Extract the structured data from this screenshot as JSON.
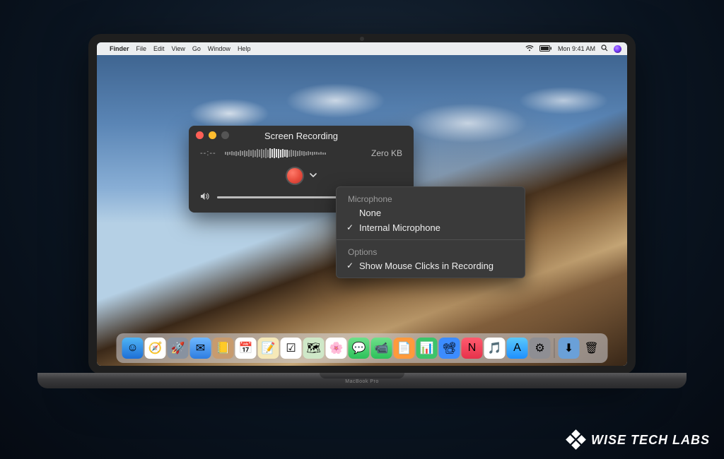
{
  "laptop": {
    "model": "MacBook Pro"
  },
  "menubar": {
    "app": "Finder",
    "items": [
      "File",
      "Edit",
      "View",
      "Go",
      "Window",
      "Help"
    ],
    "clock": "Mon 9:41 AM"
  },
  "panel": {
    "title": "Screen Recording",
    "time": "--:--",
    "size": "Zero KB"
  },
  "dropdown": {
    "section1": "Microphone",
    "opt_none": "None",
    "opt_internal": "Internal Microphone",
    "section2": "Options",
    "opt_clicks": "Show Mouse Clicks in Recording"
  },
  "dock": {
    "items": [
      {
        "name": "finder",
        "bg": "linear-gradient(#4fb4f5,#1e6fd6)",
        "glyph": "☺"
      },
      {
        "name": "safari",
        "bg": "#fff",
        "glyph": "🧭"
      },
      {
        "name": "launchpad",
        "bg": "#8892a0",
        "glyph": "🚀"
      },
      {
        "name": "mail",
        "bg": "linear-gradient(#6fb8ff,#2e7de0)",
        "glyph": "✉"
      },
      {
        "name": "contacts",
        "bg": "#c89b6e",
        "glyph": "📒"
      },
      {
        "name": "calendar",
        "bg": "#fff",
        "glyph": "📅"
      },
      {
        "name": "notes",
        "bg": "#f6e9b8",
        "glyph": "📝"
      },
      {
        "name": "reminders",
        "bg": "#fff",
        "glyph": "☑"
      },
      {
        "name": "maps",
        "bg": "#cfe8c8",
        "glyph": "🗺"
      },
      {
        "name": "photos",
        "bg": "#fff",
        "glyph": "🌸"
      },
      {
        "name": "messages",
        "bg": "linear-gradient(#6fe08a,#2cc25a)",
        "glyph": "💬"
      },
      {
        "name": "facetime",
        "bg": "linear-gradient(#6fe08a,#2cc25a)",
        "glyph": "📹"
      },
      {
        "name": "pages",
        "bg": "#ff9a3c",
        "glyph": "📄"
      },
      {
        "name": "numbers",
        "bg": "#3cc46a",
        "glyph": "📊"
      },
      {
        "name": "keynote",
        "bg": "#3c8cff",
        "glyph": "📽"
      },
      {
        "name": "news",
        "bg": "linear-gradient(#ff5b6e,#e6324b)",
        "glyph": "N"
      },
      {
        "name": "itunes",
        "bg": "#fff",
        "glyph": "🎵"
      },
      {
        "name": "appstore",
        "bg": "linear-gradient(#5ac8fa,#1e90ff)",
        "glyph": "A"
      },
      {
        "name": "preferences",
        "bg": "#8e8e93",
        "glyph": "⚙"
      }
    ],
    "extras": [
      {
        "name": "downloads",
        "bg": "#6aa0d8",
        "glyph": "⬇"
      },
      {
        "name": "trash",
        "bg": "transparent",
        "glyph": "🗑"
      }
    ]
  },
  "watermark": {
    "text": "WISE TECH LABS"
  }
}
